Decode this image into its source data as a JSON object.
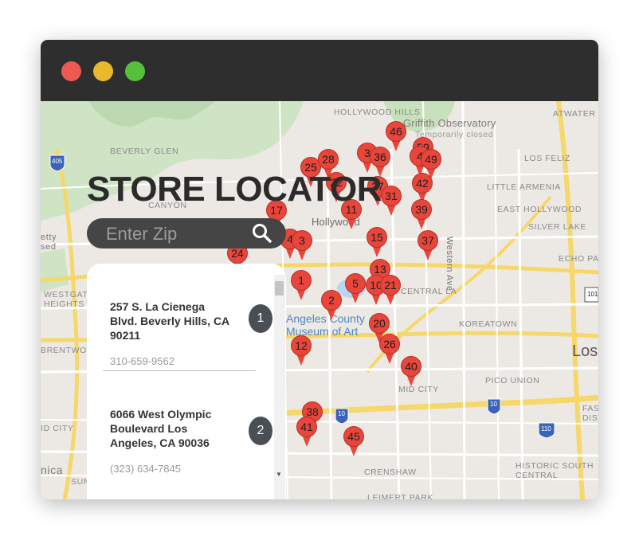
{
  "window": {
    "controls": [
      "close",
      "minimize",
      "maximize"
    ]
  },
  "colors": {
    "close": "#ee5a52",
    "minimize": "#e6b92f",
    "maximize": "#56c03d",
    "pin": "#e8463b",
    "titlebar": "#2e2e2e"
  },
  "header": {
    "title": "STORE LOCATOR"
  },
  "search": {
    "placeholder": "Enter Zip",
    "icon": "search-icon"
  },
  "stores": [
    {
      "address": "257 S. La Cienega Blvd. Beverly Hills, CA 90211",
      "phone": "310-659-9562",
      "number": "1"
    },
    {
      "address": "6066 West Olympic Boulevard Los Angeles, CA 90036",
      "phone": "(323) 634-7845",
      "number": "2"
    }
  ],
  "map": {
    "labels": {
      "hollywood_hills": "HOLLYWOOD HILLS",
      "griffith": "Griffith Observatory",
      "temp_closed": "Temporarily closed",
      "atwater": "ATWATER VILLAGE",
      "beverly_glen": "BEVERLY GLEN",
      "los_feliz": "LOS FELIZ",
      "little_armenia": "LITTLE ARMENIA",
      "canyon": "CANYON",
      "hollywood": "Hollywood",
      "east_hollywood": "EAST HOLLYWOOD",
      "silver_lake": "SILVER LAKE",
      "echo_park": "ECHO PAR",
      "western_ave": "Western Ave",
      "westgate": "WESTGAT HEIGHTS",
      "central_la": "CENTRAL LA",
      "lacma": "Angeles County Museum of Art",
      "koreatown": "KOREATOWN",
      "brentwood": "BRENTWOO",
      "los": "Los",
      "pico_union": "PICO UNION",
      "mid_city": "MID CITY",
      "fas": "FAS DIST",
      "id_city": "ID CITY",
      "crenshaw": "CRENSHAW",
      "historic": "HISTORIC SOUTH CENTRAL",
      "nica": "nica",
      "sun": "SUN",
      "getty": "etty sed",
      "leimert": "LEIMERT PARK",
      "hwy_405": "405",
      "hwy_101": "101",
      "hwy_10a": "10",
      "hwy_10b": "10",
      "hwy_110": "110"
    },
    "markers": [
      "46",
      "59",
      "3",
      "36",
      "4",
      "49",
      "25",
      "28",
      "22",
      "27",
      "42",
      "31",
      "17",
      "11",
      "39",
      "15",
      "37",
      "4",
      "3",
      "24",
      "13",
      "1",
      "5",
      "10",
      "21",
      "2",
      "20",
      "26",
      "12",
      "40",
      "38",
      "41",
      "45"
    ]
  }
}
